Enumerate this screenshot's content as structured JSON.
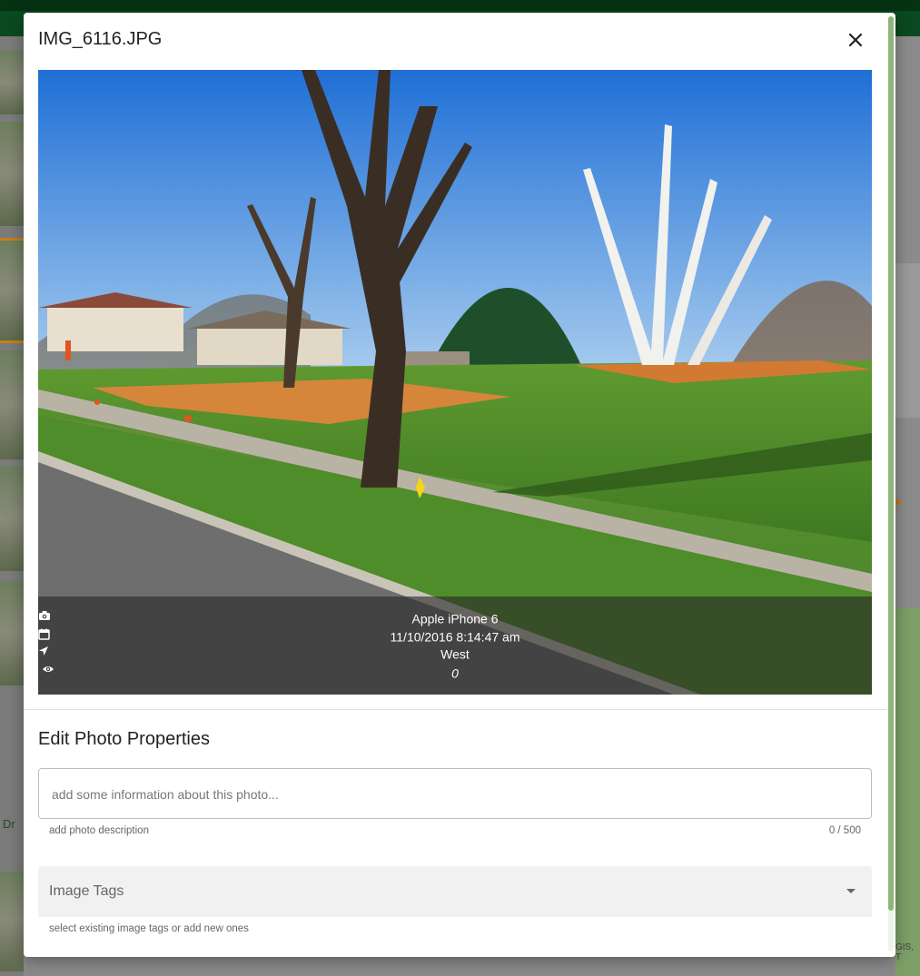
{
  "dialog": {
    "title": "IMG_6116.JPG",
    "close_icon": "close-icon"
  },
  "photo": {
    "camera_icon": "camera-icon",
    "camera": "Apple iPhone 6",
    "date_icon": "calendar-icon",
    "datetime": "11/10/2016 8:14:47 am",
    "direction_icon": "navigation-arrow-icon",
    "direction": "West",
    "views": "0",
    "views_icon": "eye-icon"
  },
  "edit": {
    "title": "Edit Photo Properties",
    "description_placeholder": "add some information about this photo...",
    "description_value": "",
    "description_hint": "add photo description",
    "description_counter": "0 / 500",
    "tags_label": "Image Tags",
    "tags_dropdown_icon": "dropdown-arrow-icon",
    "tags_hint": "select existing image tags or add new ones"
  },
  "background": {
    "street_fragment": "Dr",
    "attribution_fragment": "GIS, T"
  },
  "colors": {
    "header_green": "#0b4a20",
    "scrollbar_green": "#8fb57a",
    "tags_bg": "#f1f1f1"
  }
}
